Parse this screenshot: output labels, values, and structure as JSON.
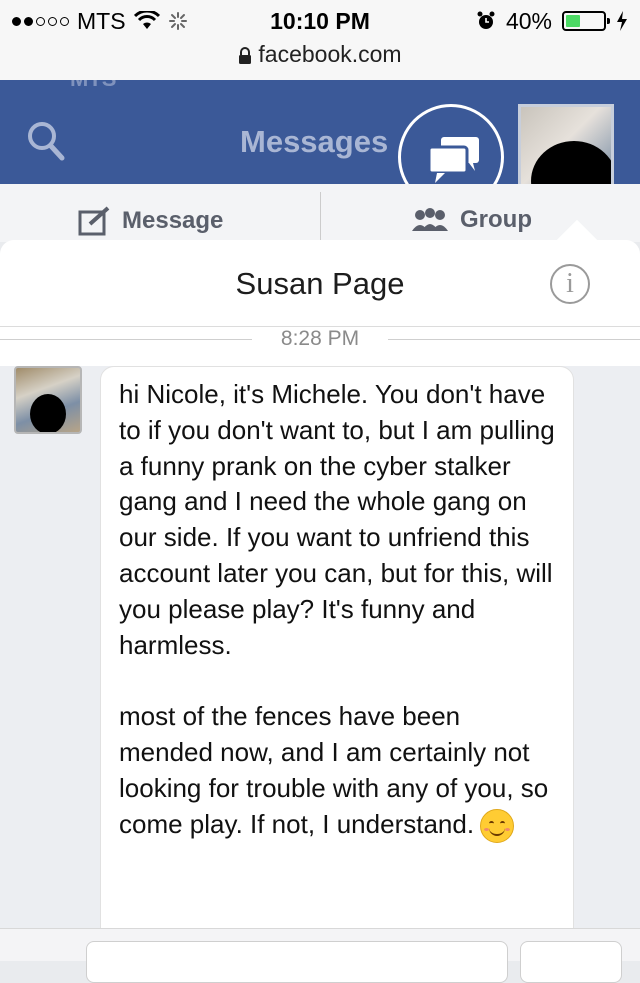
{
  "status_bar": {
    "carrier": "MTS",
    "time": "10:10 PM",
    "battery": "40%",
    "battery_fraction": 0.4,
    "url": "facebook.com"
  },
  "fb_header": {
    "title": "Messages",
    "ghost_text": "MTS"
  },
  "compose": {
    "message_label": "Message",
    "group_label": "Group"
  },
  "conversation": {
    "name": "Susan Page",
    "timestamp": "8:28 PM",
    "message_paragraph_1": "hi Nicole, it's Michele. You don't have to if you don't want to, but I am pulling a funny prank on the cyber stalker gang and I need the whole gang on our side. If you want to unfriend this account later you can, but for this, will you please play? It's funny and harmless.",
    "message_paragraph_2": "most of the fences have been mended now, and I am certainly not looking for trouble with any of you, so come play. If not, I understand.",
    "emoji": "smiling-face-emoji"
  },
  "colors": {
    "facebook_blue": "#3b5998",
    "bubble_bg": "#ffffff",
    "thread_bg": "#eceef2"
  }
}
